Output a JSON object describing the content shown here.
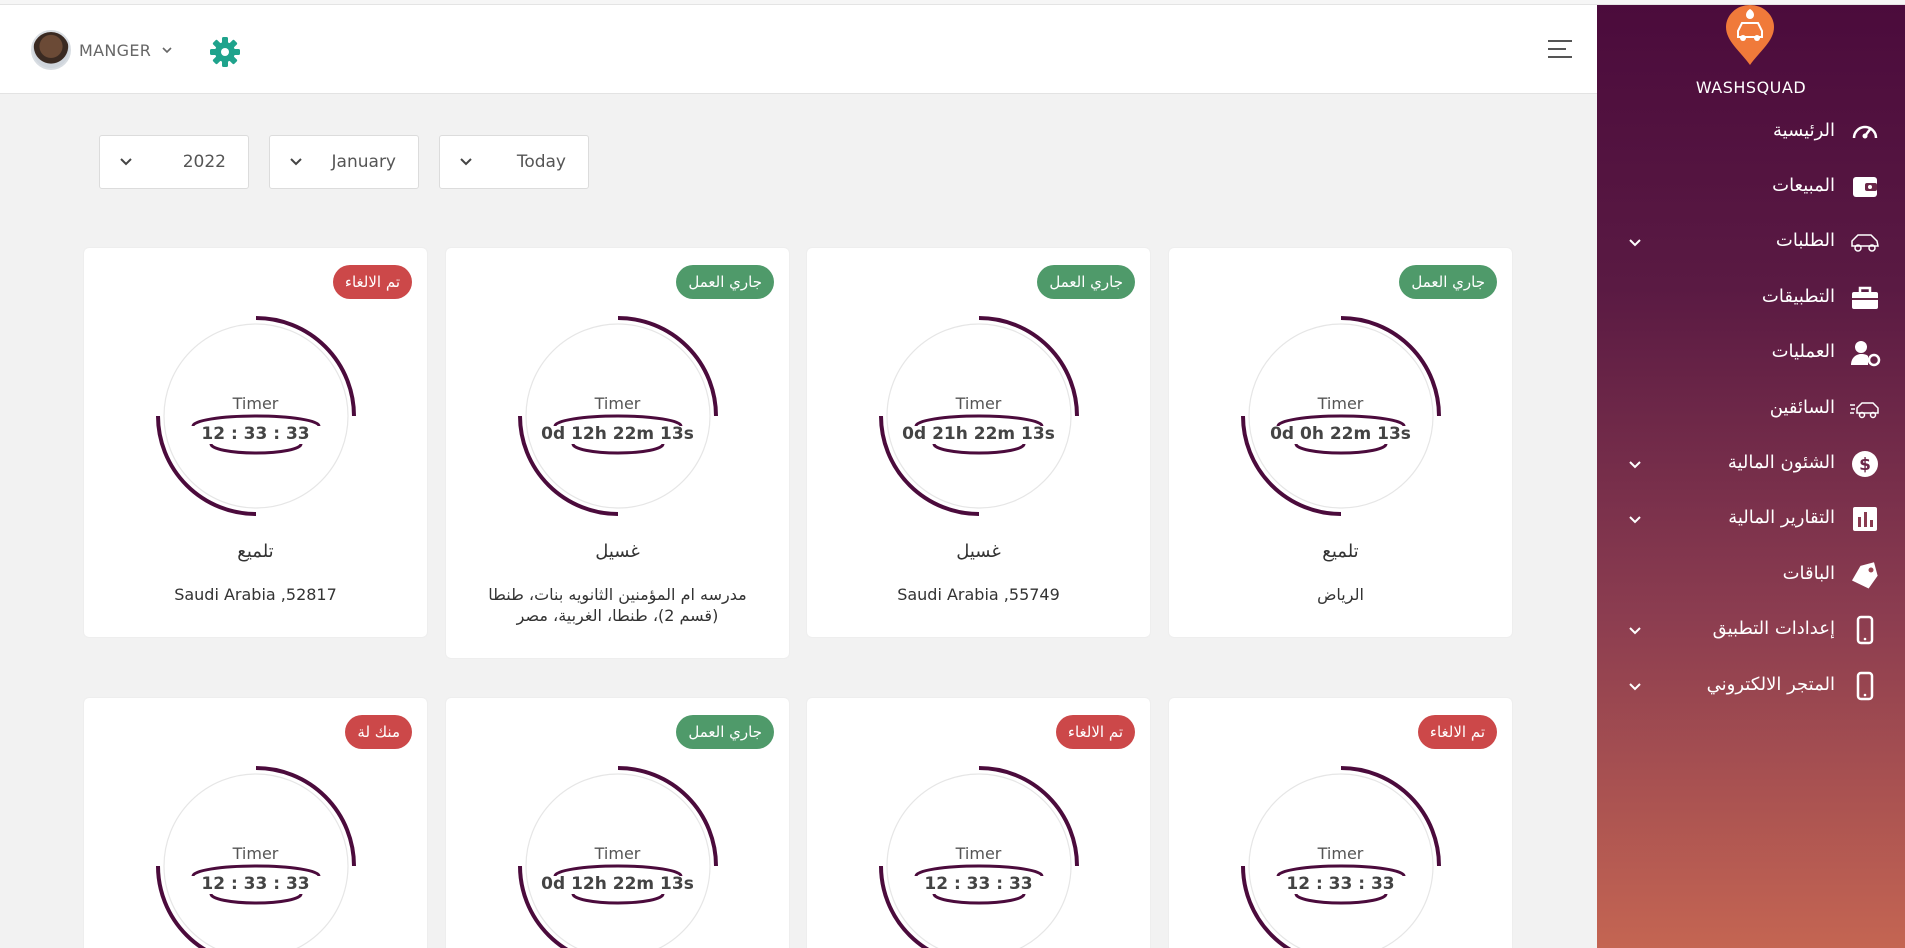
{
  "header": {
    "user_name": "MANGER"
  },
  "filters": {
    "year": "2022",
    "month": "January",
    "period": "Today"
  },
  "timer_label": "Timer",
  "cards": [
    {
      "badge": "جاري العمل",
      "status": "working",
      "timer": "0d 0h 22m 13s",
      "service": "تلميع",
      "address": "الرياض"
    },
    {
      "badge": "جاري العمل",
      "status": "working",
      "timer": "0d 21h 22m 13s",
      "service": "غسيل",
      "address": "55749, Saudi Arabia"
    },
    {
      "badge": "جاري العمل",
      "status": "working",
      "timer": "0d 12h 22m 13s",
      "service": "غسيل",
      "address": "مدرسه ام المؤمنين الثانويه بنات، طنطا (قسم 2)، طنطا، الغربية، مصر"
    },
    {
      "badge": "تم الالغاء",
      "status": "cancelled",
      "timer": "12 : 33 : 33",
      "service": "تلميع",
      "address": "52817, Saudi Arabia"
    },
    {
      "badge": "تم الالغاء",
      "status": "cancelled",
      "timer": "12 : 33 : 33"
    },
    {
      "badge": "تم الالغاء",
      "status": "cancelled",
      "timer": "12 : 33 : 33"
    },
    {
      "badge": "جاري العمل",
      "status": "working",
      "timer": "0d 12h 22m 13s"
    },
    {
      "badge": "منك لة",
      "status": "cancelled",
      "timer": "12 : 33 : 33"
    }
  ],
  "sidebar": {
    "brand": "WASHSQUAD",
    "items": [
      {
        "label": "الرئيسية",
        "icon": "speedometer-icon",
        "has_submenu": false
      },
      {
        "label": "المبيعات",
        "icon": "wallet-icon",
        "has_submenu": false
      },
      {
        "label": "الطلبات",
        "icon": "car-wash-icon",
        "has_submenu": true
      },
      {
        "label": "التطبيقات",
        "icon": "briefcase-icon",
        "has_submenu": false
      },
      {
        "label": "العمليات",
        "icon": "user-gear-icon",
        "has_submenu": false
      },
      {
        "label": "السائقين",
        "icon": "delivery-car-icon",
        "has_submenu": false
      },
      {
        "label": "الشئون المالية",
        "icon": "dollar-icon",
        "has_submenu": true
      },
      {
        "label": "التقارير المالية",
        "icon": "bar-chart-icon",
        "has_submenu": true
      },
      {
        "label": "الباقات",
        "icon": "tag-icon",
        "has_submenu": false
      },
      {
        "label": "إعدادات التطبيق",
        "icon": "mobile-icon",
        "has_submenu": true
      },
      {
        "label": "المتجر الالكتروني",
        "icon": "mobile-icon",
        "has_submenu": true
      }
    ]
  },
  "colors": {
    "accent": "#4b0b3c",
    "working": "#4f9a6a",
    "cancelled": "#cc4849",
    "gear": "#1fa38c",
    "logo": "#f07a3a"
  }
}
